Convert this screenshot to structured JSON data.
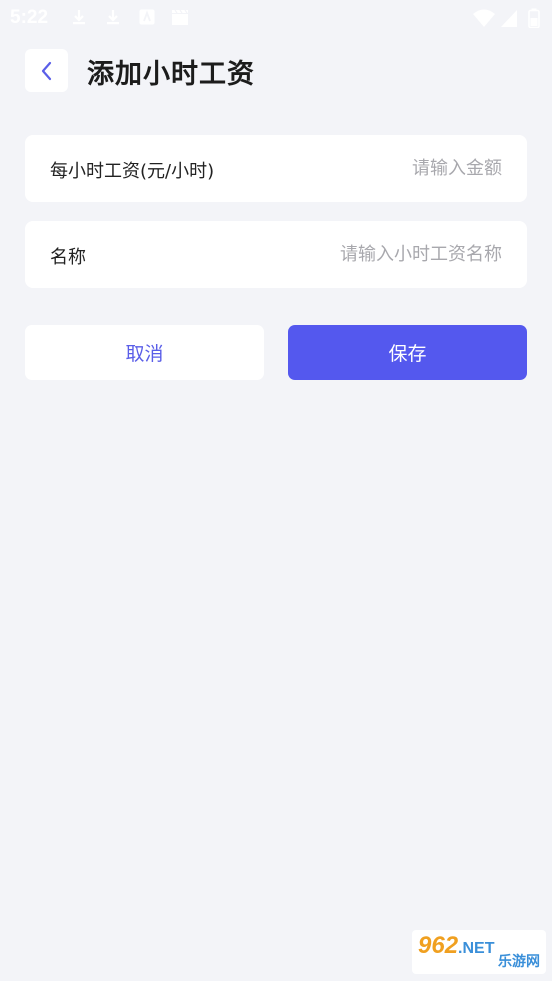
{
  "status_bar": {
    "time": "5:22",
    "icons": [
      "download-icon",
      "download-icon",
      "app-icon",
      "clapperboard-icon",
      "wifi-icon",
      "signal-icon",
      "battery-icon"
    ]
  },
  "header": {
    "back_icon": "chevron-left-icon",
    "title": "添加小时工资"
  },
  "form": {
    "hourly_wage": {
      "label": "每小时工资(元/小时)",
      "placeholder": "请输入金额",
      "value": ""
    },
    "name": {
      "label": "名称",
      "placeholder": "请输入小时工资名称",
      "value": ""
    }
  },
  "actions": {
    "cancel_label": "取消",
    "save_label": "保存"
  },
  "colors": {
    "background": "#f3f4f8",
    "accent": "#5458ee",
    "card": "#ffffff"
  },
  "watermark": {
    "top": "962",
    "net": ".NET",
    "bottom": "乐游网"
  }
}
